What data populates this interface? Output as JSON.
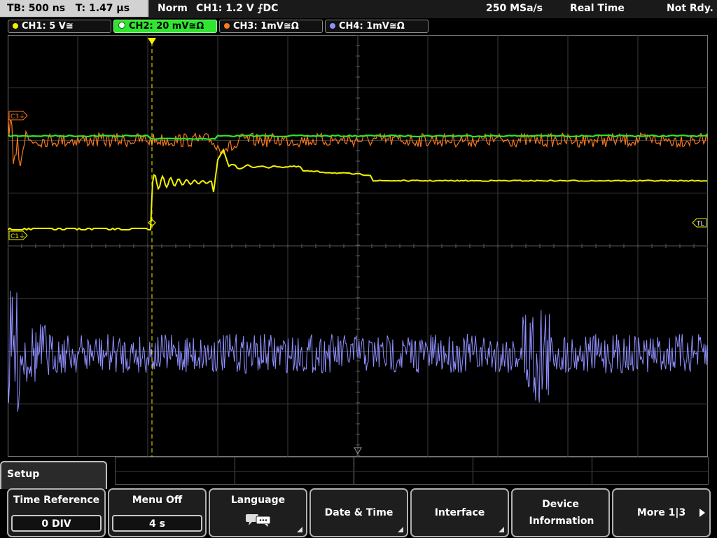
{
  "status": {
    "timebase": "TB: 500 ns",
    "trigger_time": "T: 1.47 µs",
    "mode": "Norm",
    "trigger": "CH1: 1.2 V ⨍DC",
    "sample_rate": "250 MSa/s",
    "acq_mode": "Real Time",
    "readiness": "Not Rdy."
  },
  "channels": [
    {
      "label": "CH1: 5 V≅",
      "color": "#f2f200"
    },
    {
      "label": "CH2: 20 mV≅Ω",
      "color": "#2fe52f"
    },
    {
      "label": "CH3: 1mV≅Ω",
      "color": "#ff7a1a"
    },
    {
      "label": "CH4: 1mV≅Ω",
      "color": "#8f8fff"
    }
  ],
  "markers": {
    "c1": "C1⏚",
    "c3": "C3⏚",
    "tl": "TL"
  },
  "menu": {
    "title": "Setup",
    "softkeys": [
      {
        "title": "Time Reference",
        "value": "0 DIV"
      },
      {
        "title": "Menu Off",
        "value": "4 s"
      },
      {
        "title": "Language",
        "icon": "speech-bubble-icon"
      },
      {
        "title": "Date & Time"
      },
      {
        "title": "Interface"
      },
      {
        "title": "Device Information"
      },
      {
        "title": "More 1|3"
      }
    ]
  }
}
